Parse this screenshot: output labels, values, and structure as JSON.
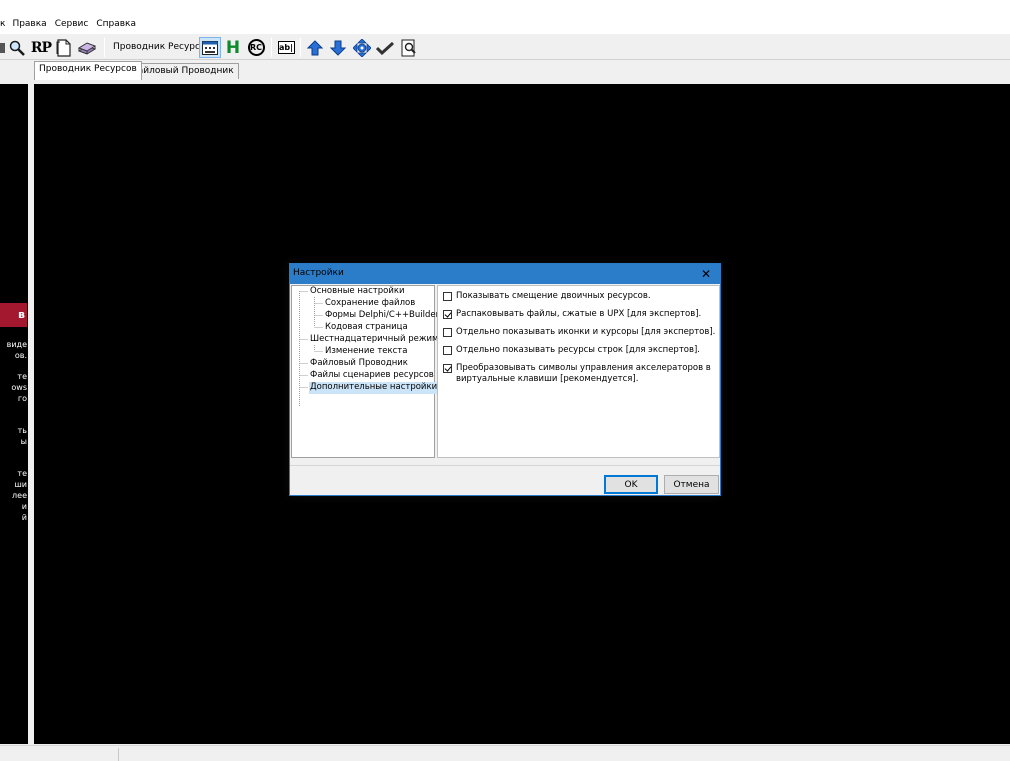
{
  "menu": {
    "items": [
      {
        "label": "к"
      },
      {
        "label": "Правка"
      },
      {
        "label": "Сервис"
      },
      {
        "label": "Справка"
      }
    ]
  },
  "toolbar": {
    "resources_label": "Проводник Ресурсов:",
    "rp_text": "RP",
    "h_text": "H",
    "rc_text": "RC",
    "ab_text": "ab|"
  },
  "tabs": [
    {
      "label": "Проводник Ресурсов"
    },
    {
      "label": "Файловый Проводник"
    }
  ],
  "left_panel": {
    "red_char": "в",
    "lines_a": [
      "виде",
      "ов."
    ],
    "lines_b": [
      "те",
      "ows",
      "го"
    ],
    "lines_c": [
      "ть",
      "ы"
    ],
    "lines_d": [
      "те",
      "ши",
      "лее",
      "и",
      "й"
    ]
  },
  "dialog": {
    "title": "Настройки",
    "close_glyph": "✕",
    "tree": [
      {
        "label": "Основные настройки"
      },
      {
        "label": "Сохранение файлов"
      },
      {
        "label": "Формы Delphi/C++Builder"
      },
      {
        "label": "Кодовая страница"
      },
      {
        "label": "Шестнадцатеричный режим"
      },
      {
        "label": "Изменение текста"
      },
      {
        "label": "Файловый Проводник"
      },
      {
        "label": "Файлы сценариев ресурсов"
      },
      {
        "label": "Дополнительные настройки"
      }
    ],
    "options": [
      {
        "label": "Показывать смещение двоичных ресурсов.",
        "checked": false
      },
      {
        "label": "Распаковывать файлы, сжатые в UPX [для экспертов].",
        "checked": true
      },
      {
        "label": "Отдельно показывать иконки и курсоры [для экспертов].",
        "checked": false
      },
      {
        "label": "Отдельно показывать ресурсы строк [для экспертов].",
        "checked": false
      },
      {
        "label": "Преобразовывать символы управления акселераторов в",
        "label2": "виртуальные клавиши [рекомендуется].",
        "checked": true
      }
    ],
    "ok_label": "OK",
    "cancel_label": "Отмена"
  }
}
